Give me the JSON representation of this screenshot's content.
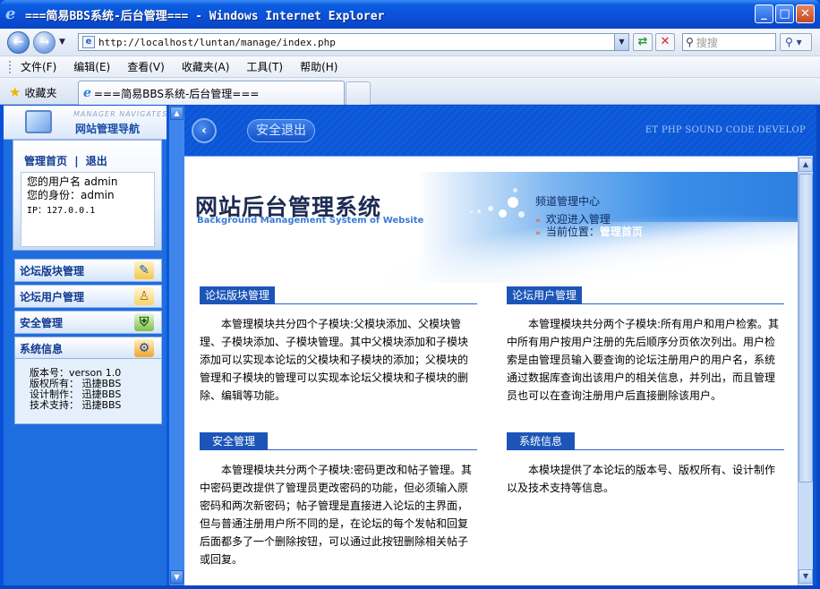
{
  "window": {
    "title": "===简易BBS系统-后台管理=== - Windows Internet Explorer",
    "min": "_",
    "max": "□",
    "close": "✕"
  },
  "address": {
    "url": "http://localhost/luntan/manage/index.php",
    "search_placeholder": "搜搜"
  },
  "menu": [
    "文件(F)",
    "编辑(E)",
    "查看(V)",
    "收藏夹(A)",
    "工具(T)",
    "帮助(H)"
  ],
  "favorites": {
    "label": "收藏夹"
  },
  "tab": {
    "title": "===简易BBS系统-后台管理==="
  },
  "sidebar": {
    "header_en": "MANAGER NAVIGATES",
    "header_cn": "网站管理导航",
    "home_link": "管理首页",
    "separator": "|",
    "logout_link": "退出",
    "username_label": "您的用户名",
    "username": "admin",
    "role_label": "您的身份：",
    "role": "admin",
    "ip_label": "IP：",
    "ip": "127.0.0.1",
    "items": [
      {
        "label": "论坛版块管理",
        "icon": "forum-edit-icon"
      },
      {
        "label": "论坛用户管理",
        "icon": "user-icon"
      },
      {
        "label": "安全管理",
        "icon": "security-icon"
      },
      {
        "label": "系统信息",
        "icon": "gears-icon"
      }
    ],
    "info": {
      "version": "版本号：verson 1.0",
      "copyright": "版权所有： 迅捷BBS",
      "design": "设计制作： 迅捷BBS",
      "support": "技术支持： 迅捷BBS"
    }
  },
  "topbar": {
    "logout_button": "安全退出",
    "dev_text": "ET PHP SOUND CODE DEVELOP"
  },
  "banner": {
    "title_cn": "网站后台管理系统",
    "title_en": "Background Management System of Website",
    "channel": "频道管理中心",
    "welcome": "欢迎进入管理",
    "location_label": "当前位置：",
    "location": "管理首页"
  },
  "sections": [
    {
      "title": "论坛版块管理",
      "body": "本管理模块共分四个子模块:父模块添加、父模块管理、子模块添加、子模块管理。其中父模块添加和子模块添加可以实现本论坛的父模块和子模块的添加；父模块的管理和子模块的管理可以实现本论坛父模块和子模块的删除、编辑等功能。"
    },
    {
      "title": "论坛用户管理",
      "body": "本管理模块共分两个子模块:所有用户和用户检索。其中所有用户按用户注册的先后顺序分页依次列出。用户检索是由管理员输入要查询的论坛注册用户的用户名，系统通过数据库查询出该用户的相关信息，并列出，而且管理员也可以在查询注册用户后直接删除该用户。"
    },
    {
      "title": "安全管理",
      "body": "本管理模块共分两个子模块:密码更改和帖子管理。其中密码更改提供了管理员更改密码的功能，但必须输入原密码和两次新密码；帖子管理是直接进入论坛的主界面，但与普通注册用户所不同的是，在论坛的每个发帖和回复后面都多了一个删除按钮，可以通过此按钮删除相关帖子或回复。"
    },
    {
      "title": "系统信息",
      "body": "本模块提供了本论坛的版本号、版权所有、设计制作以及技术支持等信息。"
    }
  ]
}
